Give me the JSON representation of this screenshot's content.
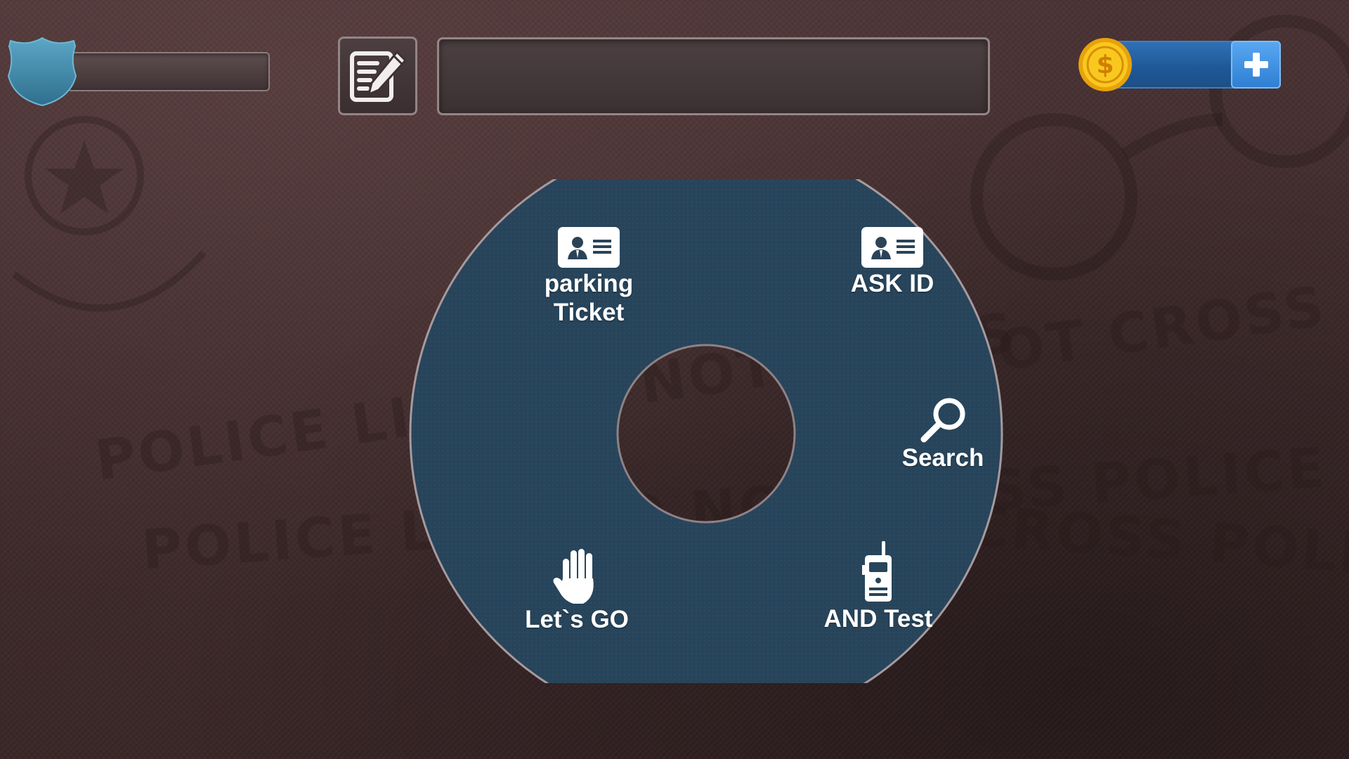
{
  "hud": {
    "badge_icon": "police-badge-icon",
    "notes_icon": "notepad-pencil-icon",
    "coin_icon": "dollar-coin-icon",
    "add_icon": "plus-icon",
    "message_text": "",
    "badge_value": "",
    "coin_value": ""
  },
  "menu": {
    "items": [
      {
        "id": "parking-ticket",
        "label": "parking\nTicket",
        "icon": "id-card-icon"
      },
      {
        "id": "ask-id",
        "label": "ASK ID",
        "icon": "id-card-icon"
      },
      {
        "id": "search",
        "label": "Search",
        "icon": "magnifier-icon"
      },
      {
        "id": "lets-go",
        "label": "Let`s GO",
        "icon": "hand-stop-icon"
      },
      {
        "id": "and-test",
        "label": "AND Test",
        "icon": "walkie-talkie-icon"
      }
    ]
  },
  "colors": {
    "menu_fill": "#27445a",
    "menu_border": "#a69a9e",
    "coin_bar": "#2566a8",
    "coin_gold": "#f7c219",
    "badge_blue": "#3f86a6"
  }
}
